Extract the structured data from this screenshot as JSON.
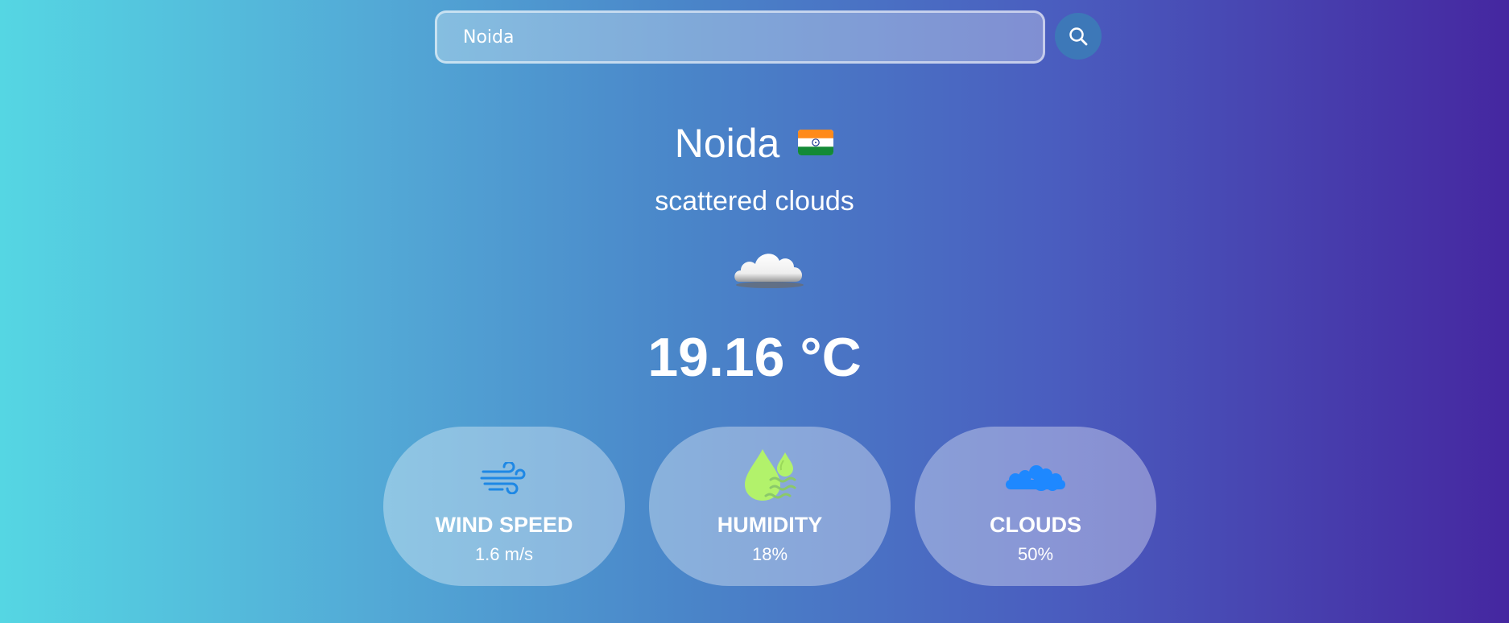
{
  "search": {
    "value": "Noida",
    "icon": "search-icon"
  },
  "weather": {
    "city": "Noida",
    "country_flag": "india-flag",
    "description": "scattered clouds",
    "icon": "cloud-icon",
    "temperature": "19.16 °C"
  },
  "cards": [
    {
      "title": "WIND SPEED",
      "value": "1.6 m/s",
      "icon": "wind-icon",
      "color": "#1e88e5"
    },
    {
      "title": "HUMIDITY",
      "value": "18%",
      "icon": "humidity-drops-icon",
      "color": "#b2f26b"
    },
    {
      "title": "CLOUDS",
      "value": "50%",
      "icon": "clouds-icon",
      "color": "#1e88ff"
    }
  ]
}
